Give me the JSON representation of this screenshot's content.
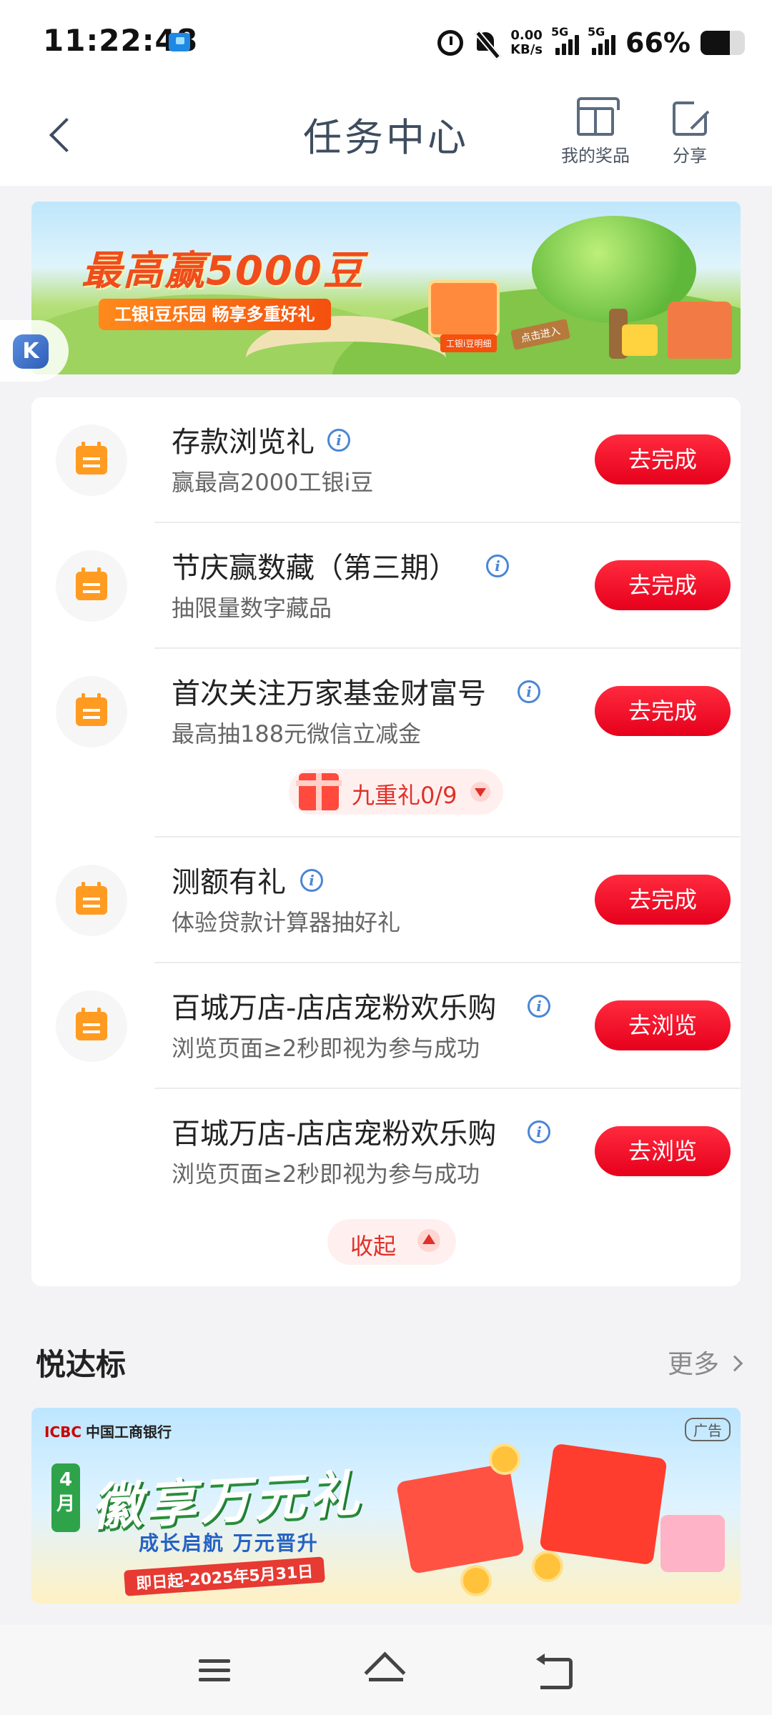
{
  "status_bar": {
    "time": "11:22:48",
    "net_speed_value": "0.00",
    "net_speed_unit": "KB/s",
    "signal1_label": "5G",
    "signal2_label": "5G",
    "battery_percent": "66%",
    "battery_level": 0.66
  },
  "header": {
    "title": "任务中心",
    "my_prizes_label": "我的奖品",
    "share_label": "分享"
  },
  "banner": {
    "title": "最高赢5000豆",
    "subtitle": "工银i豆乐园 畅享多重好礼",
    "box_label": "工银i豆明细",
    "sign_label": "点击进入"
  },
  "tasks": [
    {
      "title": "存款浏览礼",
      "subtitle": "赢最高2000工银i豆",
      "button": "去完成"
    },
    {
      "title": "节庆赢数藏（第三期）",
      "subtitle": "抽限量数字藏品",
      "button": "去完成"
    },
    {
      "title": "首次关注万家基金财富号",
      "subtitle": "最高抽188元微信立减金",
      "button": "去完成"
    },
    {
      "title": "测额有礼",
      "subtitle": "体验贷款计算器抽好礼",
      "button": "去完成"
    },
    {
      "title": "百城万店-店店宠粉欢乐购",
      "subtitle": "浏览页面≥2秒即视为参与成功",
      "button": "去浏览"
    },
    {
      "title": "百城万店-店店宠粉欢乐购",
      "subtitle": "浏览页面≥2秒即视为参与成功",
      "button": "去浏览"
    }
  ],
  "nine_gift": {
    "label": "九重礼0/9"
  },
  "collapse": {
    "label": "收起"
  },
  "section": {
    "title": "悦达标",
    "more": "更多"
  },
  "ad": {
    "logo_short": "ICBC",
    "logo_bank": "中国工商银行",
    "tag": "广告",
    "month": "4月",
    "title": "徽享万元礼",
    "subtitle": "成长启航  万元晋升",
    "date": "即日起-2025年5月31日"
  },
  "icons": {
    "back": "back-arrow-icon",
    "gift": "gift-icon",
    "share": "share-icon",
    "calendar": "calendar-icon",
    "info": "info-icon",
    "menu": "menu-icon",
    "home": "home-icon",
    "return": "return-icon"
  },
  "colors": {
    "accent_red": "#e6001b",
    "calendar_orange": "#ff9b21",
    "info_blue": "#4a86d6"
  }
}
